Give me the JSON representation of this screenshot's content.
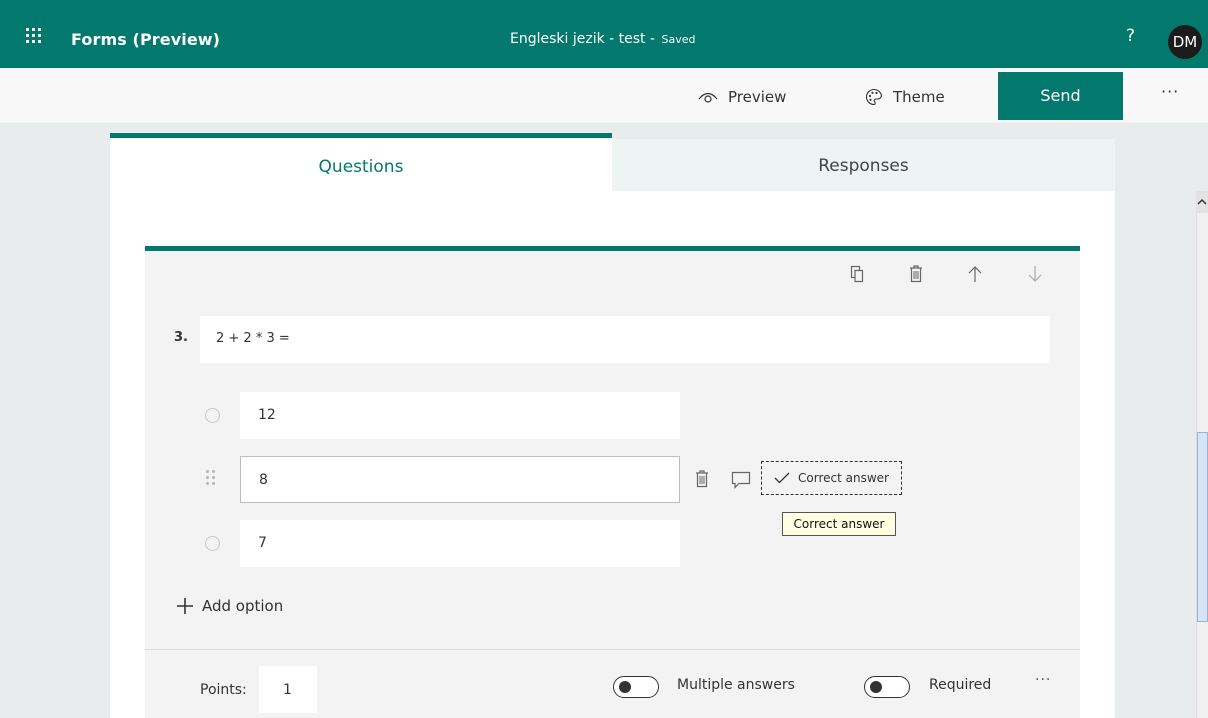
{
  "header": {
    "app_title": "Forms (Preview)",
    "doc_title": "Engleski jezik - test",
    "separator": " - ",
    "status": "Saved",
    "help": "?",
    "avatar_initials": "DM"
  },
  "commands": {
    "preview": "Preview",
    "theme": "Theme",
    "send": "Send",
    "more": "···"
  },
  "tabs": {
    "questions": "Questions",
    "responses": "Responses"
  },
  "question": {
    "number": "3.",
    "text": "2 + 2 * 3 =",
    "options": [
      {
        "text": "12"
      },
      {
        "text": "8"
      },
      {
        "text": "7"
      }
    ],
    "correct_answer_label": "Correct answer",
    "tooltip": "Correct answer",
    "add_option": "Add option",
    "points_label": "Points:",
    "points_value": "1",
    "multiple_answers_label": "Multiple answers",
    "required_label": "Required",
    "more": "···"
  },
  "colors": {
    "brand": "#03786d"
  }
}
